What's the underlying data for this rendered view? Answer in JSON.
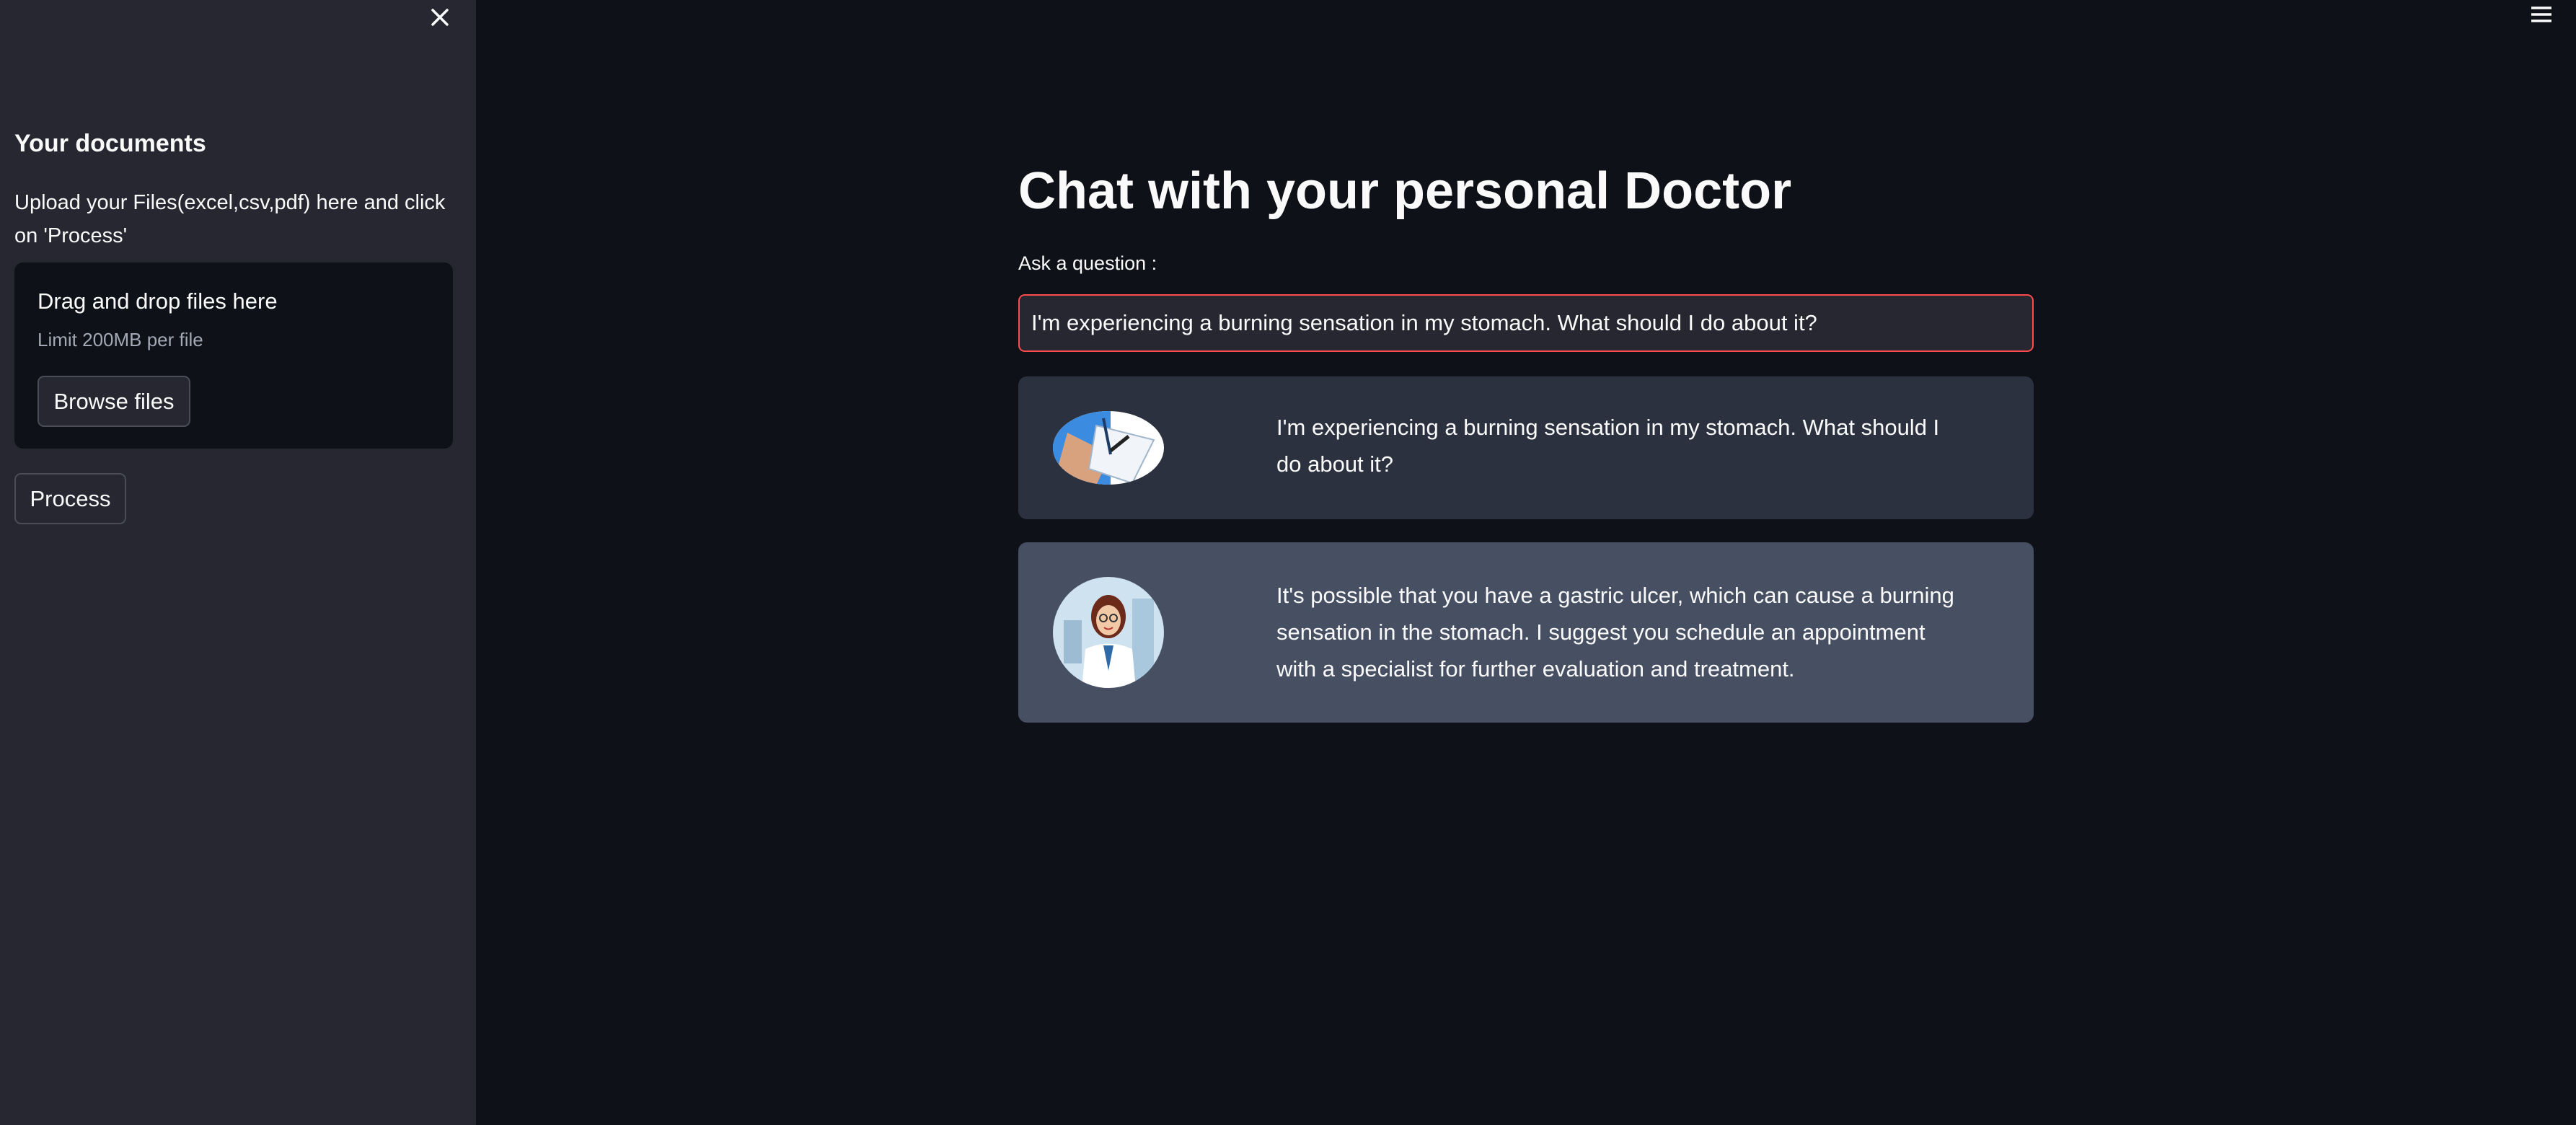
{
  "sidebar": {
    "title": "Your documents",
    "description": "Upload your Files(excel,csv,pdf) here and click on 'Process'",
    "dropzone": {
      "title": "Drag and drop files here",
      "limit": "Limit 200MB per file",
      "browse_label": "Browse files"
    },
    "process_label": "Process"
  },
  "main": {
    "title": "Chat with your personal Doctor",
    "question_label": "Ask a question :",
    "question_value": "I'm experiencing a burning sensation in my stomach. What should I do about it?",
    "messages": [
      {
        "role": "user",
        "text": "I'm experiencing a burning sensation in my stomach. What should I do about it?"
      },
      {
        "role": "bot",
        "text": "It's possible that you have a gastric ulcer, which can cause a burning sensation in the stomach. I suggest you schedule an appointment with a specialist for further evaluation and treatment."
      }
    ]
  },
  "colors": {
    "sidebar_bg": "#262730",
    "main_bg": "#0e1117",
    "user_msg_bg": "#2b313e",
    "bot_msg_bg": "#475063",
    "input_focus_border": "#ff4b4b"
  }
}
